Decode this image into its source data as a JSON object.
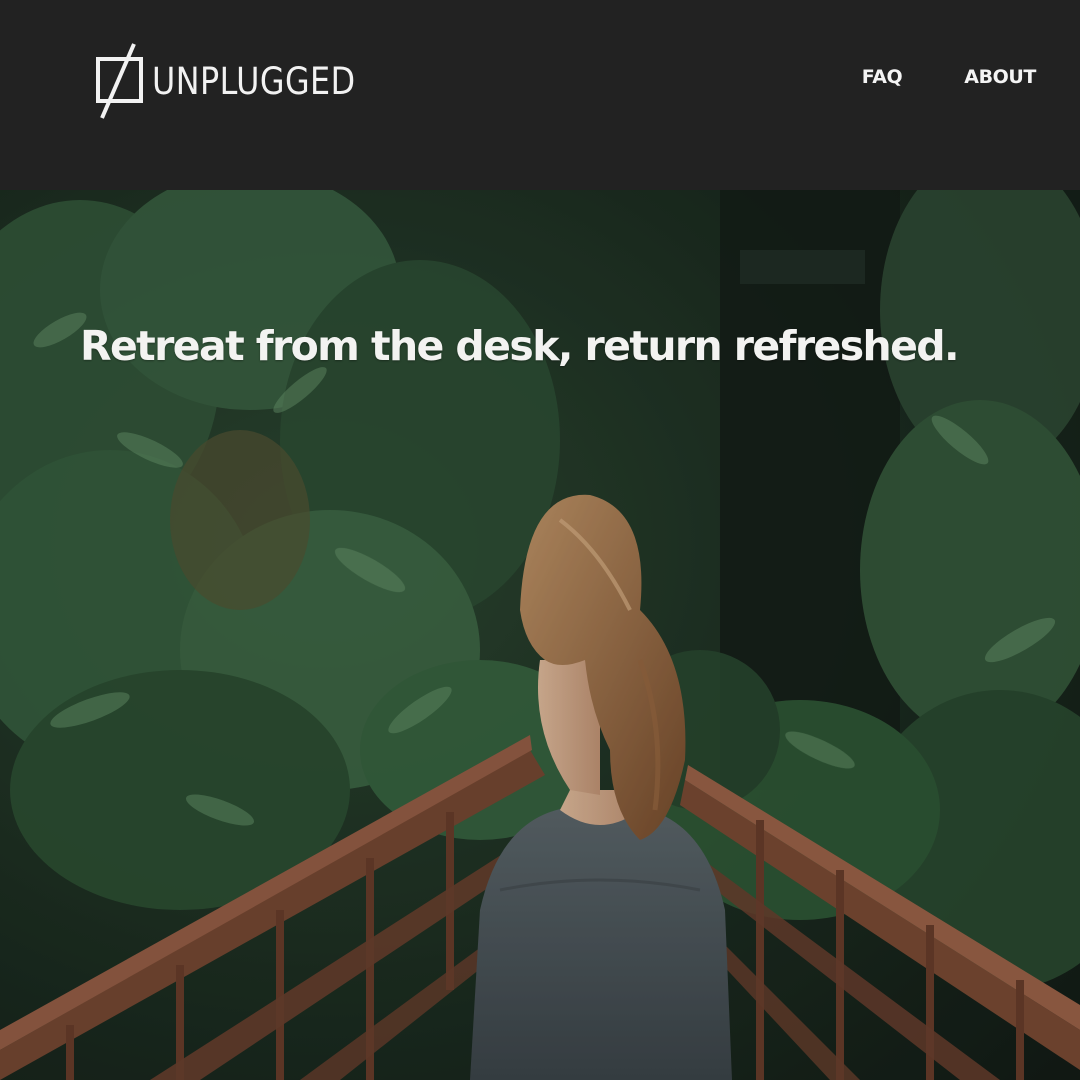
{
  "brand": {
    "name": "UNPLUGGED",
    "logo_icon": "slashed-square-icon"
  },
  "nav": {
    "items": [
      {
        "label": "FAQ"
      },
      {
        "label": "ABOUT"
      }
    ]
  },
  "hero": {
    "headline": "Retreat from the desk, return refreshed.",
    "image": "woman-on-forest-bridge"
  },
  "colors": {
    "header_bg": "#222222",
    "nav_text": "#f4f4f4",
    "headline_text": "#f3f3f1"
  }
}
